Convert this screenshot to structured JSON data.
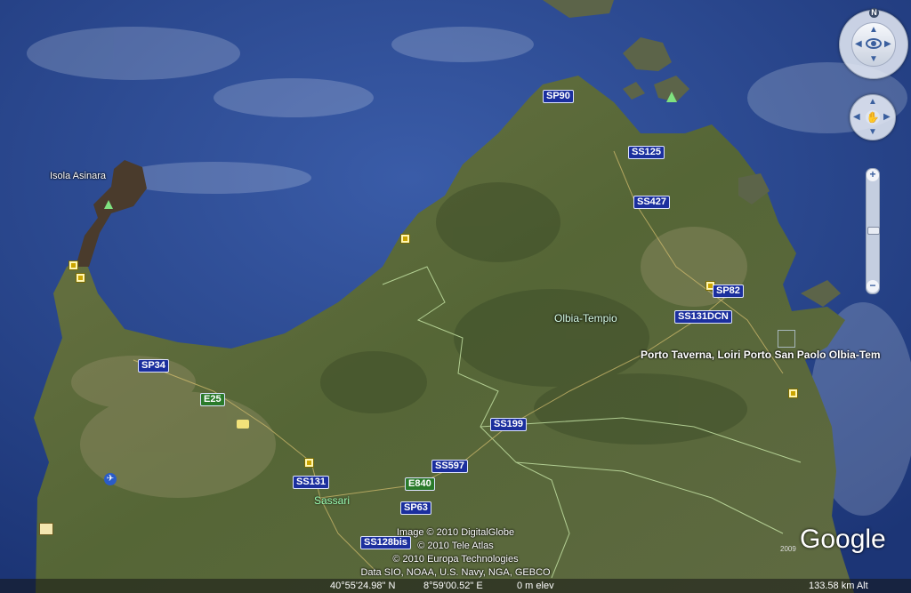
{
  "labels": {
    "isola": "Isola Asinara",
    "region": "Olbia-Tempio",
    "city": "Sassari",
    "featured": "Porto Taverna, Loiri Porto San Paolo Olbia-Tem"
  },
  "roads": {
    "sp90": "SP90",
    "ss125": "SS125",
    "ss427": "SS427",
    "sp82": "SP82",
    "ss131dcn": "SS131DCN",
    "sp34": "SP34",
    "e25": "E25",
    "ss199": "SS199",
    "ss597": "SS597",
    "ss131": "SS131",
    "e840": "E840",
    "sp63": "SP63",
    "ss128bis": "SS128bis"
  },
  "credits": {
    "line1": "Image © 2010 DigitalGlobe",
    "line2": "© 2010 Tele Atlas",
    "line3": "© 2010 Europa Technologies",
    "line4": "Data SIO, NOAA, U.S. Navy, NGA, GEBCO"
  },
  "branding": {
    "logo": "Google",
    "year": "2009"
  },
  "status": {
    "lat": "40°55'24.98\" N",
    "lon": "8°59'00.52\" E",
    "elev": "0 m elev",
    "eye_alt": "133.58 km Alt"
  },
  "compass": {
    "north": "N"
  },
  "colors": {
    "sea": "#25468f",
    "land": "#5e6a3a",
    "border": "#c9e8a9",
    "road_shield": "#1b2f9e"
  }
}
